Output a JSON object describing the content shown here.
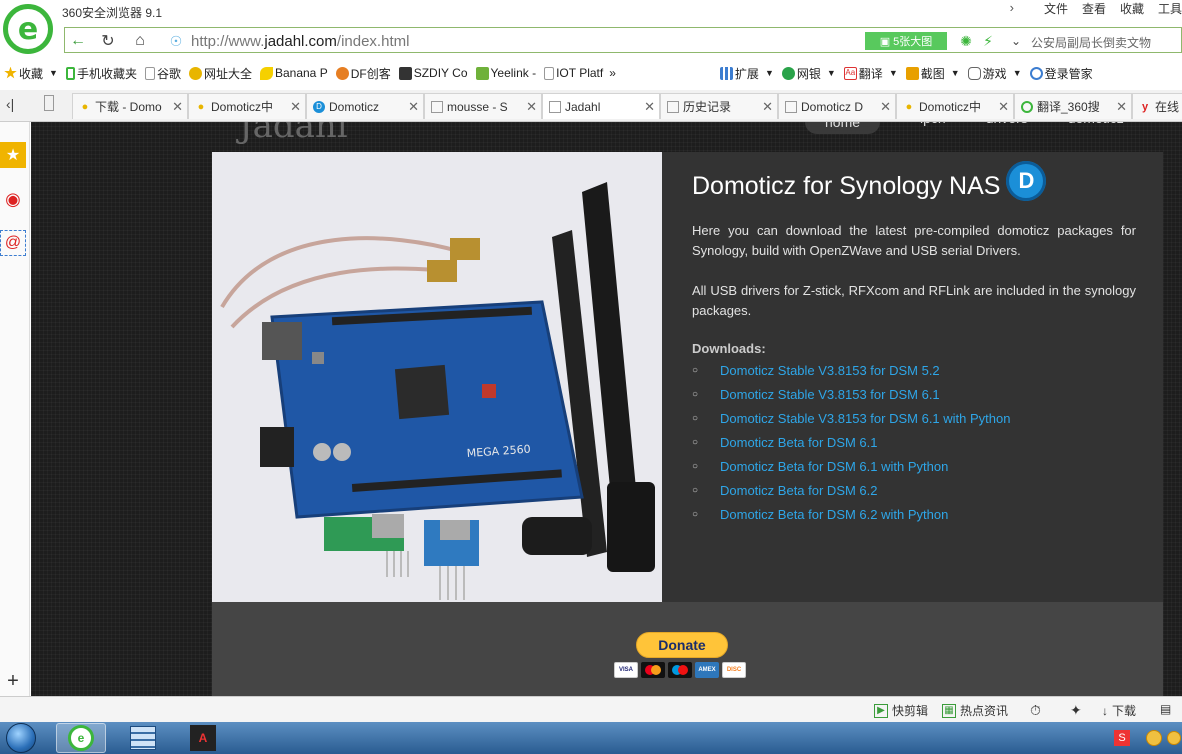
{
  "window": {
    "title": "360安全浏览器 9.1",
    "logo_letter": "e",
    "menu": [
      "文件",
      "查看",
      "收藏",
      "工具"
    ]
  },
  "toolbar": {
    "back_icon": "back-arrow-icon",
    "refresh_icon": "refresh-icon",
    "home_icon": "home-icon",
    "url_prefix": "http://www.",
    "url_host": "jadahl.com",
    "url_path": "/index.html",
    "big_image_button": "5张大图",
    "search_placeholder": "公安局副局长倒卖文物"
  },
  "bookmarks": [
    {
      "label": "收藏",
      "icon": "star-icon",
      "color": "#f0b400"
    },
    {
      "label": "手机收藏夹",
      "icon": "phone-icon",
      "color": "#3cb63c"
    },
    {
      "label": "谷歌",
      "icon": "page-icon",
      "color": "#999999"
    },
    {
      "label": "网址大全",
      "icon": "site-icon",
      "color": "#e8b500"
    },
    {
      "label": "Banana P",
      "icon": "banana-icon",
      "color": "#f5d000"
    },
    {
      "label": "DF创客",
      "icon": "df-icon",
      "color": "#e67e22"
    },
    {
      "label": "SZDIY Co",
      "icon": "szdiy-icon",
      "color": "#333333"
    },
    {
      "label": "Yeelink -",
      "icon": "yeelink-icon",
      "color": "#6fb13a"
    },
    {
      "label": "IOT Platf",
      "icon": "page-icon",
      "color": "#999999"
    },
    {
      "label": "扩展",
      "icon": "grid-icon",
      "color": "#3c7dd0"
    },
    {
      "label": "网银",
      "icon": "bank-icon",
      "color": "#2aa34a"
    },
    {
      "label": "翻译",
      "icon": "translate-icon",
      "color": "#d33"
    },
    {
      "label": "截图",
      "icon": "screenshot-icon",
      "color": "#e8a000"
    },
    {
      "label": "游戏",
      "icon": "game-icon",
      "color": "#666666"
    },
    {
      "label": "登录管家",
      "icon": "login-icon",
      "color": "#3c7dd0"
    }
  ],
  "tabs": [
    {
      "label": "下载 - Domo",
      "icon": "bulb-icon",
      "active": false
    },
    {
      "label": "Domoticz中",
      "icon": "bulb-icon",
      "active": false
    },
    {
      "label": "Domoticz",
      "icon": "domoticz-icon",
      "active": false
    },
    {
      "label": "mousse - S",
      "icon": "page-icon",
      "active": false
    },
    {
      "label": "Jadahl",
      "icon": "page-icon",
      "active": true
    },
    {
      "label": "历史记录",
      "icon": "page-icon",
      "active": false
    },
    {
      "label": "Domoticz D",
      "icon": "page-icon",
      "active": false
    },
    {
      "label": "Domoticz中",
      "icon": "bulb-icon",
      "active": false
    },
    {
      "label": "翻译_360搜",
      "icon": "so-icon",
      "active": false
    },
    {
      "label": "在线",
      "icon": "y-icon",
      "active": false
    }
  ],
  "site": {
    "brand": "Jadahl",
    "nav": [
      "home",
      "ipch",
      "drivers",
      "domoticz"
    ],
    "heading": "Domoticz for Synology NAS",
    "logo_letter": "D",
    "para1": "Here you can download the latest pre-compiled domoticz packages for Synology, build with OpenZWave and USB serial Drivers.",
    "para2": "All USB drivers for Z-stick, RFXcom and RFLink are included in the synology packages.",
    "downloads_title": "Downloads:",
    "downloads": [
      "Domoticz Stable V3.8153 for DSM 5.2",
      "Domoticz Stable V3.8153 for DSM 6.1",
      "Domoticz Stable V3.8153 for DSM 6.1 with Python",
      "Domoticz Beta for DSM 6.1",
      "Domoticz Beta for DSM 6.1 with Python",
      "Domoticz Beta for DSM 6.2",
      "Domoticz Beta for DSM 6.2 with Python"
    ],
    "board_label": "MEGA 2560",
    "donate_label": "Donate",
    "cards": [
      "VISA",
      "MC",
      "MAES",
      "AMEX",
      "DISC"
    ]
  },
  "statusbar": {
    "items": [
      "快剪辑",
      "热点资讯",
      "下载"
    ]
  }
}
